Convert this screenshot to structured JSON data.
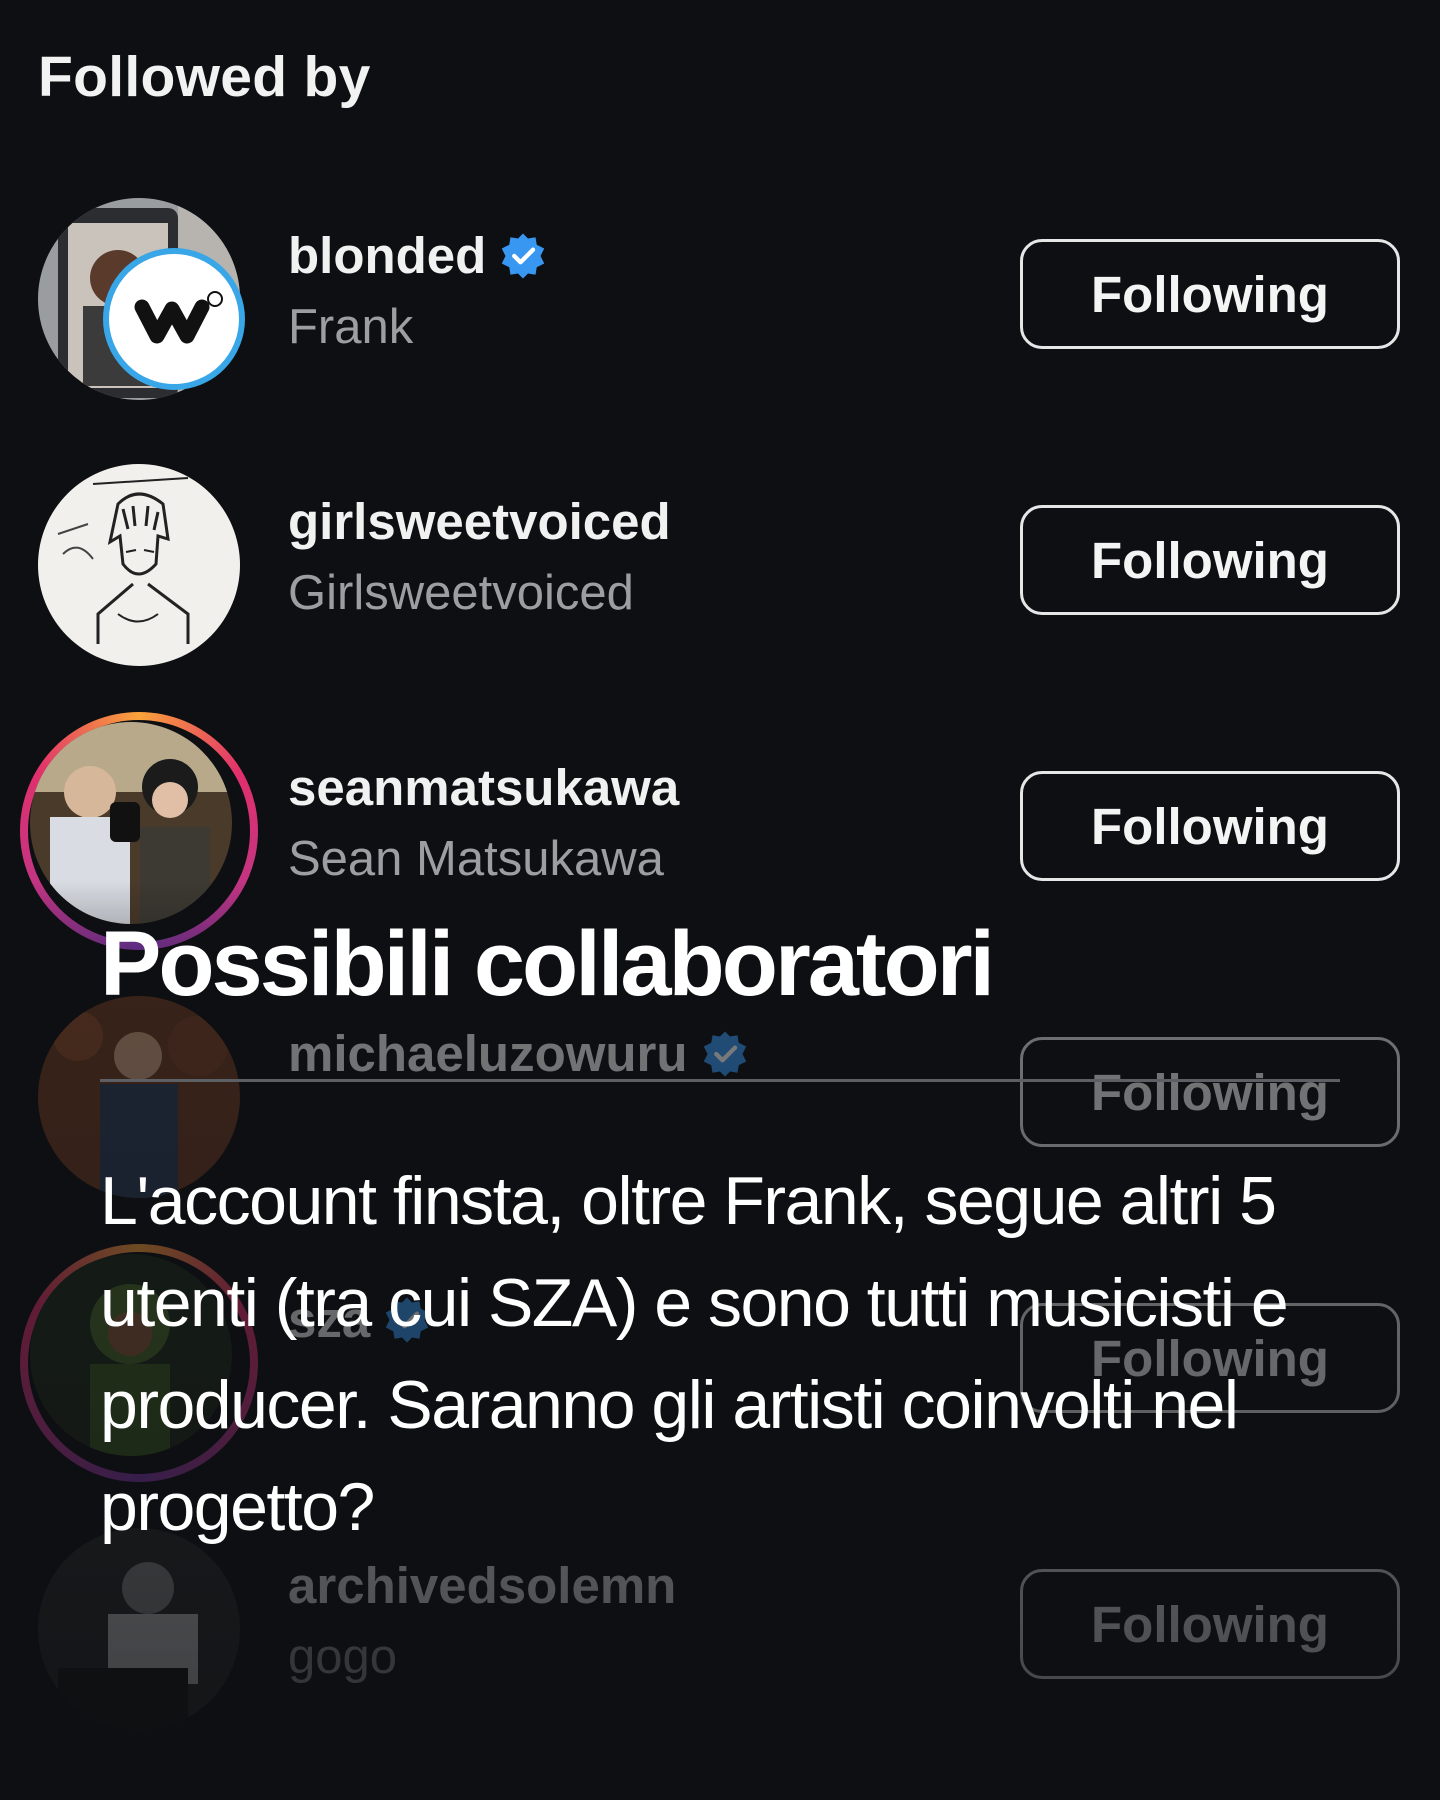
{
  "header": {
    "title": "Followed by"
  },
  "users": [
    {
      "username": "blonded",
      "full_name": "Frank",
      "verified": true,
      "story_ring": false,
      "button_label": "Following"
    },
    {
      "username": "girlsweetvoiced",
      "full_name": "Girlsweetvoiced",
      "verified": false,
      "story_ring": false,
      "button_label": "Following"
    },
    {
      "username": "seanmatsukawa",
      "full_name": "Sean Matsukawa",
      "verified": false,
      "story_ring": true,
      "button_label": "Following"
    },
    {
      "username": "michaeluzowuru",
      "full_name": "",
      "verified": true,
      "story_ring": false,
      "button_label": "Following"
    },
    {
      "username": "sza",
      "full_name": "",
      "verified": true,
      "story_ring": true,
      "button_label": "Following"
    },
    {
      "username": "archivedsolemn",
      "full_name": "gogo",
      "verified": false,
      "story_ring": false,
      "button_label": "Following"
    }
  ],
  "overlay": {
    "title": "Possibili collaboratori",
    "body": "L'account finsta, oltre Frank, segue altri 5 utenti (tra cui SZA) e sono tutti musicisti e producer. Saranno gli artisti coinvolti nel progetto?"
  },
  "colors": {
    "background": "#0d0f12",
    "verified_blue": "#3897f0",
    "muted_text": "#9b9ea3",
    "button_border": "#e6e6e6"
  }
}
